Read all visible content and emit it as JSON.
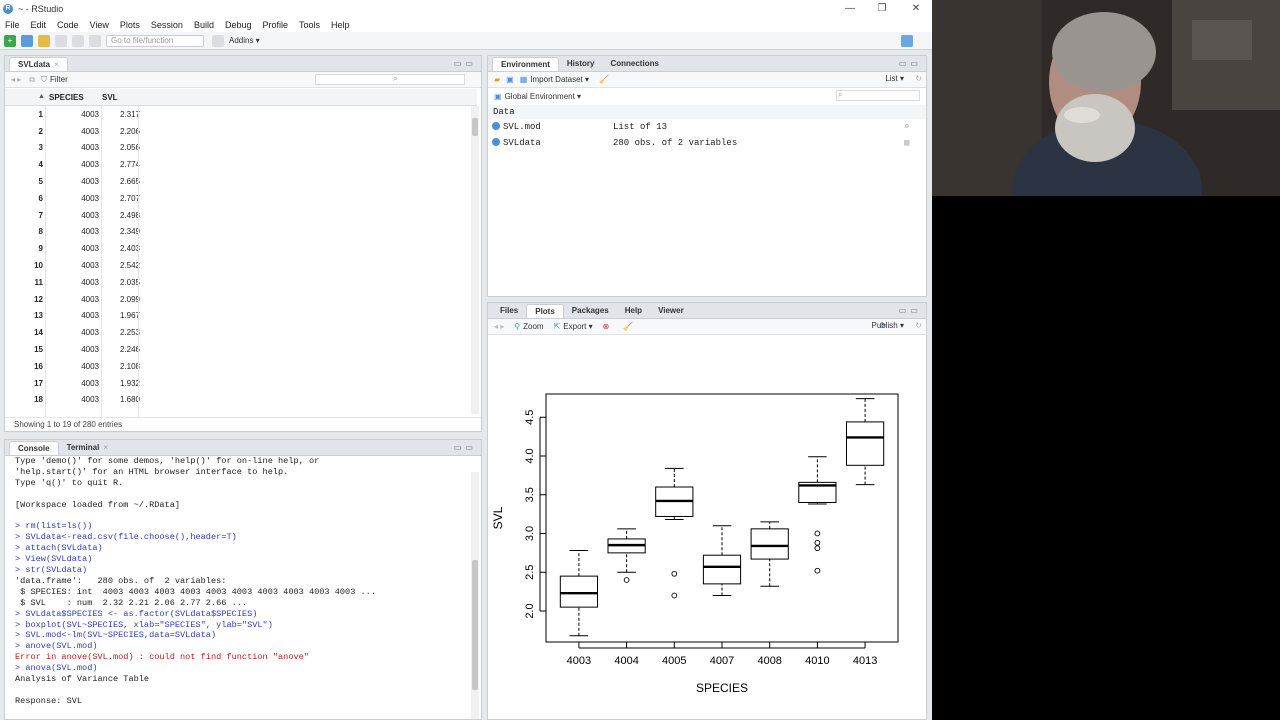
{
  "window": {
    "title": "~ - RStudio",
    "app_icon": "R",
    "controls": {
      "minimize": "—",
      "maximize": "❐",
      "close": "✕"
    }
  },
  "menu": [
    "File",
    "Edit",
    "Code",
    "View",
    "Plots",
    "Session",
    "Build",
    "Debug",
    "Profile",
    "Tools",
    "Help"
  ],
  "toolbar": {
    "goto_placeholder": "Go to file/function",
    "addins_label": "Addins ▾"
  },
  "data_viewer": {
    "tab_label": "SVLdata",
    "filter_label": "Filter",
    "columns": [
      "SPECIES",
      "SVL"
    ],
    "rows": [
      {
        "idx": "1",
        "species": "4003",
        "svl": "2.317"
      },
      {
        "idx": "2",
        "species": "4003",
        "svl": "2.206"
      },
      {
        "idx": "3",
        "species": "4003",
        "svl": "2.056"
      },
      {
        "idx": "4",
        "species": "4003",
        "svl": "2.774"
      },
      {
        "idx": "5",
        "species": "4003",
        "svl": "2.665"
      },
      {
        "idx": "6",
        "species": "4003",
        "svl": "2.707"
      },
      {
        "idx": "7",
        "species": "4003",
        "svl": "2.498"
      },
      {
        "idx": "8",
        "species": "4003",
        "svl": "2.349"
      },
      {
        "idx": "9",
        "species": "4003",
        "svl": "2.403"
      },
      {
        "idx": "10",
        "species": "4003",
        "svl": "2.542"
      },
      {
        "idx": "11",
        "species": "4003",
        "svl": "2.035"
      },
      {
        "idx": "12",
        "species": "4003",
        "svl": "2.099"
      },
      {
        "idx": "13",
        "species": "4003",
        "svl": "1.967"
      },
      {
        "idx": "14",
        "species": "4003",
        "svl": "2.253"
      },
      {
        "idx": "15",
        "species": "4003",
        "svl": "2.246"
      },
      {
        "idx": "16",
        "species": "4003",
        "svl": "2.108"
      },
      {
        "idx": "17",
        "species": "4003",
        "svl": "1.932"
      },
      {
        "idx": "18",
        "species": "4003",
        "svl": "1.680"
      }
    ],
    "footer": "Showing 1 to 19 of 280 entries"
  },
  "console": {
    "tabs": [
      "Console",
      "Terminal"
    ],
    "lines": [
      {
        "t": "out",
        "s": "Type 'demo()' for some demos, 'help()' for on-line help, or"
      },
      {
        "t": "out",
        "s": "'help.start()' for an HTML browser interface to help."
      },
      {
        "t": "out",
        "s": "Type 'q()' to quit R."
      },
      {
        "t": "out",
        "s": ""
      },
      {
        "t": "out",
        "s": "[Workspace loaded from ~/.RData]"
      },
      {
        "t": "out",
        "s": ""
      },
      {
        "t": "in",
        "s": "> rm(list=ls())"
      },
      {
        "t": "in",
        "s": "> SVLdata<-read.csv(file.choose(),header=T)"
      },
      {
        "t": "in",
        "s": "> attach(SVLdata)"
      },
      {
        "t": "in",
        "s": "> View(SVLdata)"
      },
      {
        "t": "in",
        "s": "> str(SVLdata)"
      },
      {
        "t": "out",
        "s": "'data.frame':   280 obs. of  2 variables:"
      },
      {
        "t": "out",
        "s": " $ SPECIES: int  4003 4003 4003 4003 4003 4003 4003 4003 4003 4003 ..."
      },
      {
        "t": "out",
        "s": " $ SVL    : num  2.32 2.21 2.06 2.77 2.66 ..."
      },
      {
        "t": "in",
        "s": "> SVLdata$SPECIES <- as.factor(SVLdata$SPECIES)"
      },
      {
        "t": "in",
        "s": "> boxplot(SVL~SPECIES, xlab=\"SPECIES\", ylab=\"SVL\")"
      },
      {
        "t": "in",
        "s": "> SVL.mod<-lm(SVL~SPECIES,data=SVLdata)"
      },
      {
        "t": "in",
        "s": "> anove(SVL.mod)"
      },
      {
        "t": "err",
        "s": "Error in anove(SVL.mod) : could not find function \"anove\""
      },
      {
        "t": "in",
        "s": "> anova(SVL.mod)"
      },
      {
        "t": "out",
        "s": "Analysis of Variance Table"
      },
      {
        "t": "out",
        "s": ""
      },
      {
        "t": "out",
        "s": "Response: SVL"
      }
    ]
  },
  "environment": {
    "tabs": [
      "Environment",
      "History",
      "Connections"
    ],
    "import_label": "Import Dataset ▾",
    "list_label": "List ▾",
    "scope_label": "Global Environment ▾",
    "section": "Data",
    "items": [
      {
        "name": "SVL.mod",
        "value": "List of 13"
      },
      {
        "name": "SVLdata",
        "value": "280 obs. of 2 variables"
      }
    ]
  },
  "plots_pane": {
    "tabs": [
      "Files",
      "Plots",
      "Packages",
      "Help",
      "Viewer"
    ],
    "zoom_label": "Zoom",
    "export_label": "Export ▾",
    "publish_label": "Publish ▾"
  },
  "chart_data": {
    "type": "boxplot",
    "title": "",
    "xlabel": "SPECIES",
    "ylabel": "SVL",
    "ylim": [
      1.6,
      4.8
    ],
    "yticks": [
      2.0,
      2.5,
      3.0,
      3.5,
      4.0,
      4.5
    ],
    "categories": [
      "4003",
      "4004",
      "4005",
      "4007",
      "4008",
      "4010",
      "4013"
    ],
    "boxes": [
      {
        "whisker_low": 1.68,
        "q1": 2.05,
        "median": 2.23,
        "q3": 2.45,
        "whisker_high": 2.78,
        "outliers": []
      },
      {
        "whisker_low": 2.5,
        "q1": 2.75,
        "median": 2.85,
        "q3": 2.93,
        "whisker_high": 3.06,
        "outliers": [
          2.4
        ]
      },
      {
        "whisker_low": 3.18,
        "q1": 3.22,
        "median": 3.42,
        "q3": 3.6,
        "whisker_high": 3.84,
        "outliers": [
          2.48,
          2.2
        ]
      },
      {
        "whisker_low": 2.2,
        "q1": 2.35,
        "median": 2.57,
        "q3": 2.72,
        "whisker_high": 3.1,
        "outliers": []
      },
      {
        "whisker_low": 2.32,
        "q1": 2.67,
        "median": 2.84,
        "q3": 3.06,
        "whisker_high": 3.15,
        "outliers": []
      },
      {
        "whisker_low": 3.38,
        "q1": 3.4,
        "median": 3.62,
        "q3": 3.66,
        "whisker_high": 3.99,
        "outliers": [
          3.0,
          2.88,
          2.81,
          2.52
        ]
      },
      {
        "whisker_low": 3.63,
        "q1": 3.88,
        "median": 4.24,
        "q3": 4.44,
        "whisker_high": 4.74,
        "outliers": []
      }
    ]
  }
}
